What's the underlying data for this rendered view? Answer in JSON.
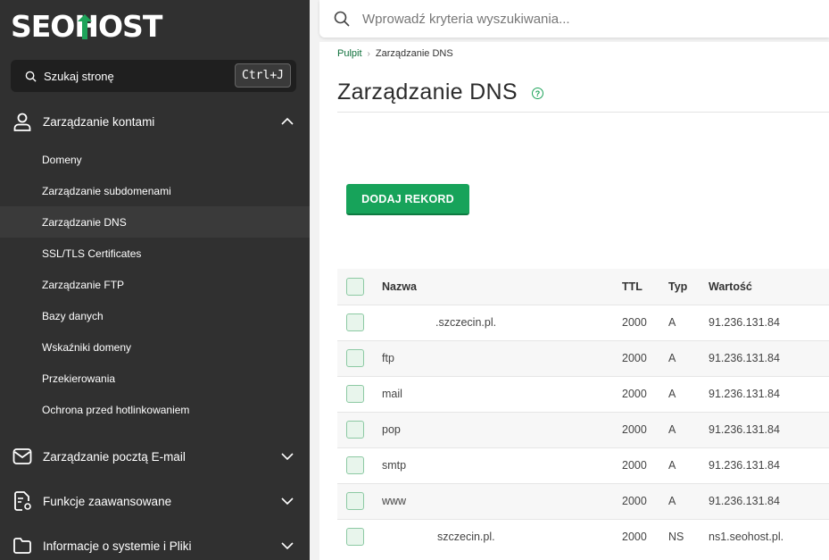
{
  "brand": {
    "logo": "SEOHOST",
    "logo_parts": [
      "SEO",
      "H",
      "OST"
    ]
  },
  "sidebar": {
    "search_label": "Szukaj stronę",
    "search_shortcut": "Ctrl+J",
    "sections": [
      {
        "label": "Zarządzanie kontami",
        "icon": "user-icon",
        "expanded": true
      },
      {
        "label": "Zarządzanie pocztą E-mail",
        "icon": "mail-icon",
        "expanded": false
      },
      {
        "label": "Funkcje zaawansowane",
        "icon": "settings-doc-icon",
        "expanded": false
      },
      {
        "label": "Informacje o systemie i Pliki",
        "icon": "folder-icon",
        "expanded": false
      }
    ],
    "account_items": [
      "Domeny",
      "Zarządzanie subdomenami",
      "Zarządzanie DNS",
      "SSL/TLS Certificates",
      "Zarządzanie FTP",
      "Bazy danych",
      "Wskaźniki domeny",
      "Przekierowania",
      "Ochrona przed hotlinkowaniem"
    ],
    "active_item": "Zarządzanie DNS"
  },
  "topbar": {
    "search_placeholder": "Wprowadź kryteria wyszukiwania..."
  },
  "breadcrumb": {
    "home": "Pulpit",
    "current": "Zarządzanie DNS"
  },
  "page": {
    "title": "Zarządzanie DNS",
    "help": "?",
    "add_button": "DODAJ REKORD"
  },
  "table": {
    "headers": {
      "name": "Nazwa",
      "ttl": "TTL",
      "type": "Typ",
      "value": "Wartość"
    },
    "rows": [
      {
        "name": ".szczecin.pl.",
        "ttl": "2000",
        "type": "A",
        "value": "91.236.131.84",
        "indent": true
      },
      {
        "name": "ftp",
        "ttl": "2000",
        "type": "A",
        "value": "91.236.131.84",
        "indent": false
      },
      {
        "name": "mail",
        "ttl": "2000",
        "type": "A",
        "value": "91.236.131.84",
        "indent": false
      },
      {
        "name": "pop",
        "ttl": "2000",
        "type": "A",
        "value": "91.236.131.84",
        "indent": false
      },
      {
        "name": "smtp",
        "ttl": "2000",
        "type": "A",
        "value": "91.236.131.84",
        "indent": false
      },
      {
        "name": "www",
        "ttl": "2000",
        "type": "A",
        "value": "91.236.131.84",
        "indent": false
      },
      {
        "name": "szczecin.pl.",
        "ttl": "2000",
        "type": "NS",
        "value": "ns1.seohost.pl.",
        "indent": true
      }
    ]
  },
  "colors": {
    "sidebar_bg": "#303030",
    "accent_green": "#17a35a",
    "link_green": "#0d6f3a"
  }
}
